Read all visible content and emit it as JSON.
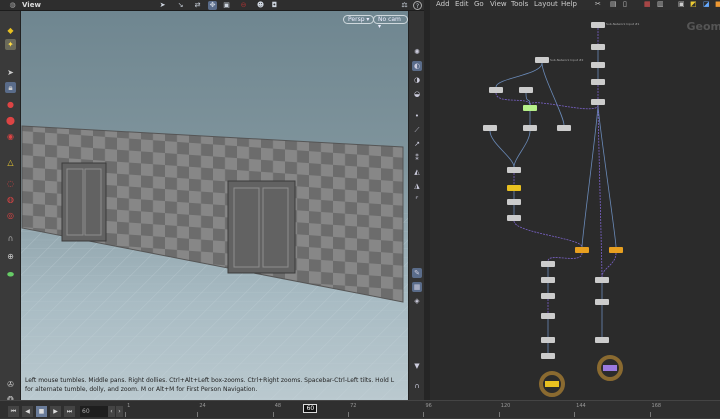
{
  "viewer": {
    "title": "View",
    "persp": "Persp ▾",
    "cam": "No cam ▾",
    "hint": "Left mouse tumbles. Middle pans. Right dollies. Ctrl+Alt+Left box-zooms. Ctrl+Right zooms. Spacebar-Ctrl-Left tilts. Hold L for alternate tumble, dolly, and zoom.     M or Alt+M for First Person Navigation.",
    "help_icon": "?"
  },
  "network": {
    "menu": [
      "Add",
      "Edit",
      "Go",
      "View",
      "Tools",
      "Layout",
      "Help"
    ],
    "context_label": "Geom",
    "nodes": {
      "subnet_input_1": "Sub-Network Input #1",
      "subnet_input_2": "Sub-Network Input #2"
    }
  },
  "timeline": {
    "frame": "60",
    "current": "60",
    "ticks": [
      "1",
      "24",
      "48",
      "72",
      "96",
      "120",
      "144",
      "168"
    ],
    "tick_values": [
      1,
      24,
      48,
      72,
      96,
      120,
      144,
      168
    ]
  },
  "colors": {
    "viewport_top": "#6f8690",
    "graph_bg": "#2b2b2b",
    "node_orange": "#e8a020",
    "node_green": "#b6f08a",
    "node_purple": "#9a7ae0"
  }
}
